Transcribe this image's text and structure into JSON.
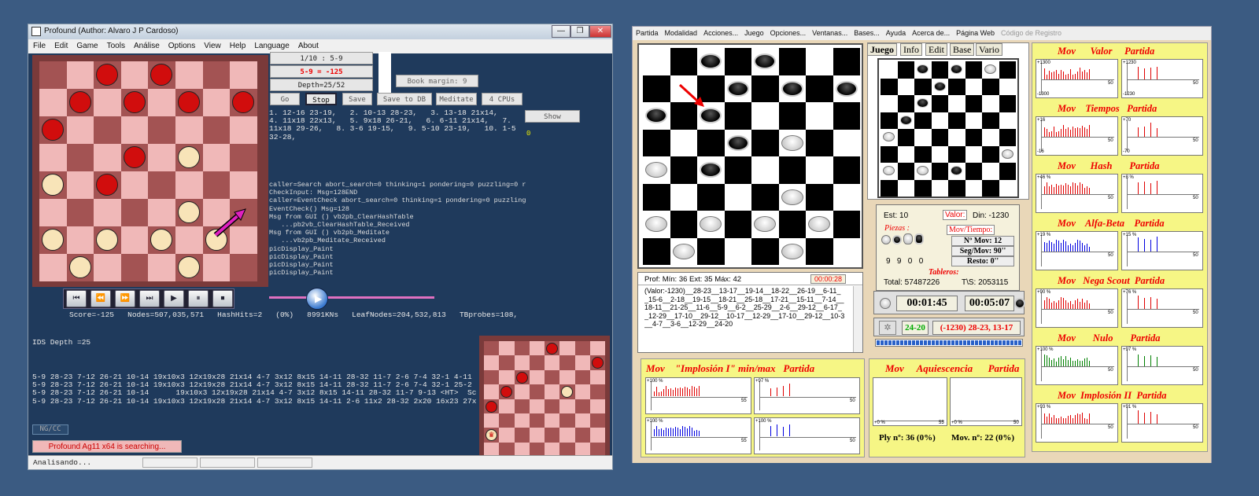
{
  "left_window": {
    "title": "Profound (Author: Alvaro J P Cardoso)",
    "window_buttons": [
      "—",
      "❐",
      "✕"
    ],
    "menu": [
      "File",
      "Edit",
      "Game",
      "Tools",
      "Análise",
      "Options",
      "View",
      "Help",
      "Language",
      "About"
    ],
    "info_boxes": [
      "1/10 : 5-9",
      "5-9 = -125",
      "Depth=25/52"
    ],
    "book_margin": "Book margin: 9",
    "buttons": [
      "Go",
      "Stop",
      "Save",
      "Save to DB",
      "Meditate",
      "4 CPUs"
    ],
    "show_button": "Show",
    "side_value": "0",
    "game_moves": "1. 12-16 23-19,   2. 10-13 28-23,   3. 13-18 21x14,\n4. 11x18 22x13,   5. 9x18 26-21,   6. 6-11 21x14,   7.\n11x18 29-26,   8. 3-6 19-15,   9. 5-10 23-19,   10. 1-5\n32-28,",
    "log": "caller=Search abort_search=0 thinking=1 pondering=0 puzzling=0 r\nCheckInput: Msg=128END\ncaller=EventCheck abort_search=0 thinking=1 pondering=0 puzzling\nEventCheck() Msg=128\nMsg from GUI () vb2pb_ClearHashTable\n   ...pb2vb_ClearHashTable_Received\nMsg from GUI () vb2pb_Meditate\n   ...vb2pb_Meditate_Received\npicDisplay_Paint\npicDisplay_Paint\npicDisplay_Paint\npicDisplay_Paint",
    "playback_icons": [
      "first-icon",
      "rewind-icon",
      "forward-icon",
      "last-icon",
      "play-icon",
      "pause-icon",
      "stop-icon"
    ],
    "playback_glyphs": [
      "⏮",
      "⏪",
      "⏩",
      "⏭",
      "▶",
      "⏸",
      "⏹"
    ],
    "stats": "Score=-125   Nodes=507,035,571   HashHits=2   (0%)   8991KNs   LeafNodes=204,532,813   TBprobes=108,",
    "ids_depth": "IDS Depth =25",
    "pv_lines": "5-9 28-23 7-12 26-21 10-14 19x10x3 12x19x28 21x14 4-7 3x12 8x15 14-11 28-32 11-7 2-6 7-4 32-1 4-11\n5-9 28-23 7-12 26-21 10-14 19x10x3 12x19x28 21x14 4-7 3x12 8x15 14-11 28-32 11-7 2-6 7-4 32-1 25-2\n5-9 28-23 7-12 26-21 10-14      19x10x3 12x19x28 21x14 4-7 3x12 8x15 14-11 28-32 11-7 9-13 <HT>  Sc\n5-9 28-23 7-12 26-21 10-14 19x10x3 12x19x28 21x14 4-7 3x12 8x15 14-11 2-6 11x2 28-32 2x20 16x23 27x",
    "ngcc": "NG/CC",
    "status_banner": "Profound Ag11 x64 is searching...",
    "status_bar": "Analisando...",
    "colors": {
      "light_square": "#f0b8b8",
      "dark_square": "#a35353",
      "red": "#d10d0d",
      "white": "#f8e4b8",
      "arrow": "#e020c0"
    }
  },
  "right_window": {
    "menu": [
      "Partida",
      "Modalidad",
      "Acciones...",
      "Juego",
      "Opciones...",
      "Ventanas...",
      "Bases...",
      "Ayuda",
      "Acerca de...",
      "Página Web",
      "Código de Registro"
    ],
    "tabs": [
      "Juego",
      "Info",
      "Edit",
      "Base",
      "Vario"
    ],
    "est": "Est: 10",
    "valor_label": "Valor:",
    "din": "Din: -1230",
    "piezas_label": "Piezas :",
    "piezas_counts": "9   9   0   0",
    "mov_tiempo_label": "Mov/Tiempo:",
    "n_mov": "Nº Mov: 12",
    "seg_mov": "Seg/Mov: 90''",
    "resto": "Resto: 0''",
    "tableros_label": "Tableros:",
    "total": "Total: 57487226",
    "ts": "T\\S: 2053115",
    "prof": "Prof: Mín: 36  Ext: 35  Máx: 42",
    "prof_time": "00:00:28",
    "pv_text": "(Valor:-1230)__28-23__13-17__19-14__18-22__26-19__6-11_\n_15-6__2-18__19-15__18-21__25-18__17-21__15-11__7-14__\n18-11__21-25__11-6__5-9__6-2__25-29__2-6__29-12__6-17_\n_12-29__17-10__29-12__10-17__12-29__17-10__29-12__10-3\n__4-7__3-6__12-29__24-20",
    "clock_white": "00:01:45",
    "clock_black": "00:05:07",
    "best_move": "24-20",
    "best_line": "(-1230) 28-23, 13-17",
    "panels": {
      "implosion": "Mov    \"Implosión I\" min/max   Partida",
      "aquiescencia": "Mov     Aquiescencia      Partida",
      "ply": "Ply nº: 36 (0%)",
      "mov_n": "Mov. nº: 22 (0%)"
    },
    "right_panels": [
      {
        "title": "Mov      Valor     Partida",
        "l1": "+1300",
        "l2": "-1300",
        "r1": "+1230",
        "r2": "-1230",
        "b1": "50",
        "b2": "50",
        "color": "#e00000"
      },
      {
        "title": "Mov    Tiempos   Partida",
        "l1": "+16",
        "l2": "-16",
        "r1": "+70",
        "r2": "-70",
        "b1": "50",
        "b2": "50",
        "color": "#e00000"
      },
      {
        "title": "Mov      Hash       Partida",
        "l1": "+46 %",
        "l2": "",
        "r1": "+8 %",
        "r2": "",
        "b1": "50",
        "b2": "50",
        "color": "#e00000"
      },
      {
        "title": "Mov    Alfa-Beta    Partida",
        "l1": "+19 %",
        "l2": "",
        "r1": "+15 %",
        "r2": "",
        "b1": "50",
        "b2": "50",
        "color": "#0000e0"
      },
      {
        "title": "Mov   Nega Scout  Partida",
        "l1": "+90 %",
        "l2": "",
        "r1": "+76 %",
        "r2": "",
        "b1": "50",
        "b2": "50",
        "color": "#e00000"
      },
      {
        "title": "Mov       Nulo       Partida",
        "l1": "+100 %",
        "l2": "",
        "r1": "+97 %",
        "r2": "",
        "b1": "50",
        "b2": "50",
        "color": "#008000"
      },
      {
        "title": "Mov  Implosión II  Partida",
        "l1": "+93 %",
        "l2": "",
        "r1": "+91 %",
        "r2": "",
        "b1": "50",
        "b2": "50",
        "color": "#e00000"
      }
    ],
    "implosion_labels": [
      "+100 %",
      "55",
      "+97 %",
      "50",
      "+100 %",
      "55",
      "+100 %",
      "50"
    ],
    "aquiescencia_labels": [
      "+0 %",
      "55",
      "+0 %",
      "50"
    ]
  }
}
